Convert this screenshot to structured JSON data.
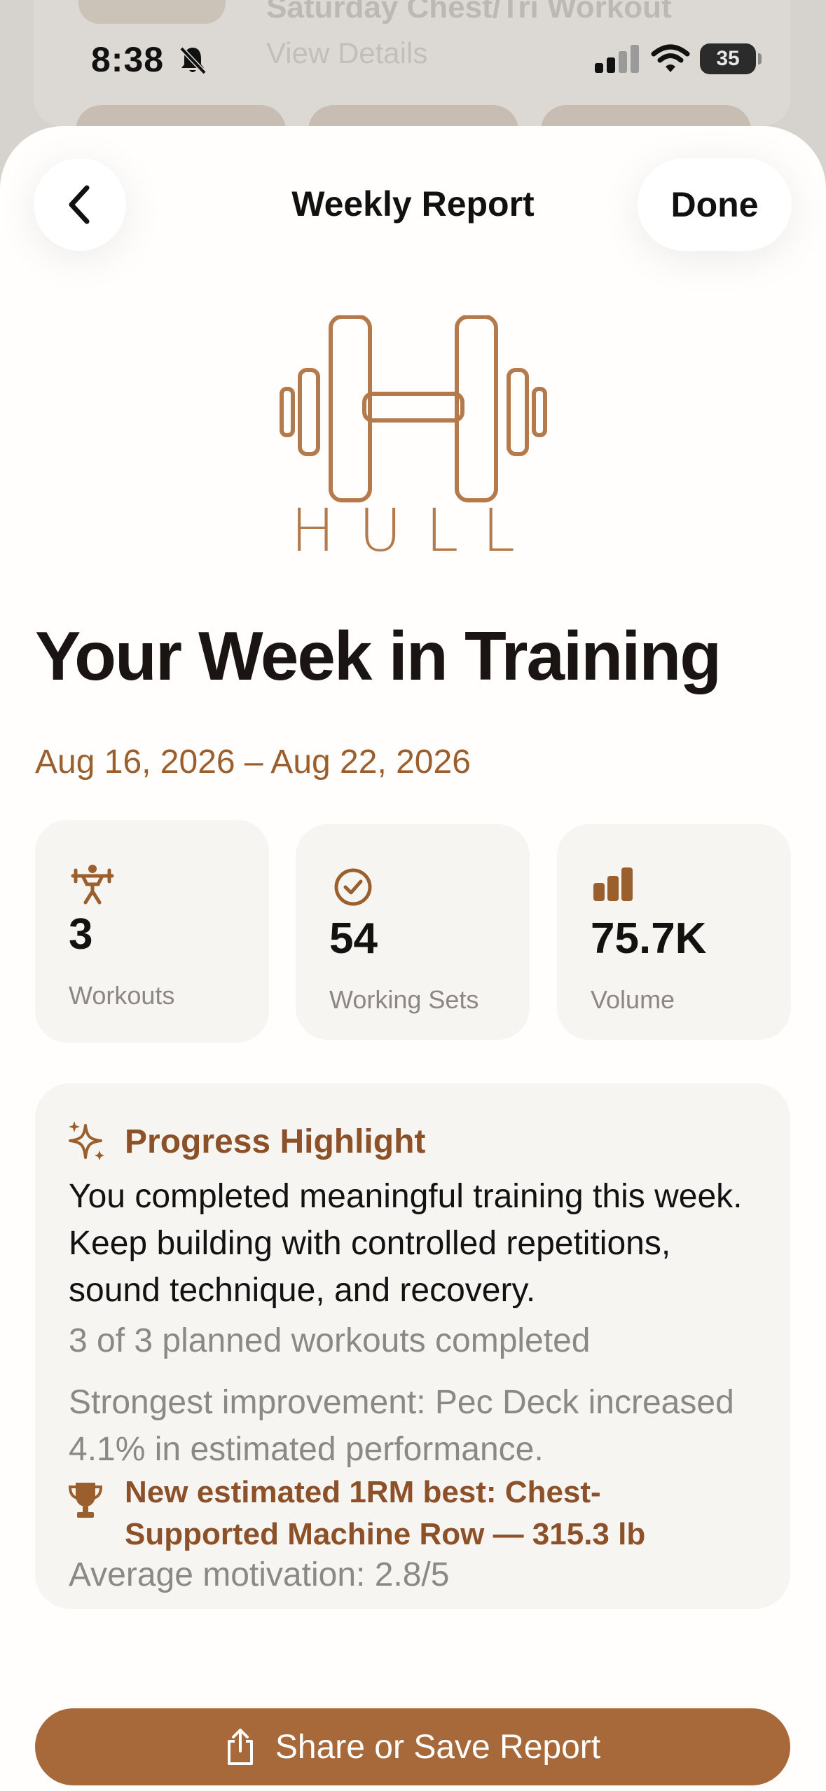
{
  "background": {
    "workout_title": "Saturday Chest/Tri Workout",
    "view_details": "View Details"
  },
  "status_bar": {
    "time": "8:38",
    "battery": "35"
  },
  "nav": {
    "title": "Weekly Report",
    "done_label": "Done"
  },
  "logo": {
    "wordmark": "HULL",
    "color": "#b47a4c"
  },
  "report": {
    "title": "Your Week in Training",
    "date_range": "Aug 16, 2026 – Aug 22, 2026"
  },
  "stats": [
    {
      "icon": "weightlifter-icon",
      "value": "3",
      "label": "Workouts"
    },
    {
      "icon": "check-circle-icon",
      "value": "54",
      "label": "Working Sets"
    },
    {
      "icon": "bar-chart-icon",
      "value": "75.7K",
      "label": "Volume"
    }
  ],
  "highlight": {
    "title": "Progress Highlight",
    "body": "You completed meaningful training this week. Keep building with controlled repetitions, sound technique, and recovery.",
    "planned": "3 of 3 planned workouts completed",
    "improvement": "Strongest improvement: Pec Deck increased 4.1% in estimated performance.",
    "record": "New estimated 1RM best: Chest-Supported Machine Row — 315.3 lb",
    "motivation": "Average motivation: 2.8/5"
  },
  "share": {
    "label": "Share or Save Report"
  },
  "colors": {
    "accent": "#a8693a",
    "accent_text": "#8c5128",
    "card": "#f7f5f1"
  }
}
